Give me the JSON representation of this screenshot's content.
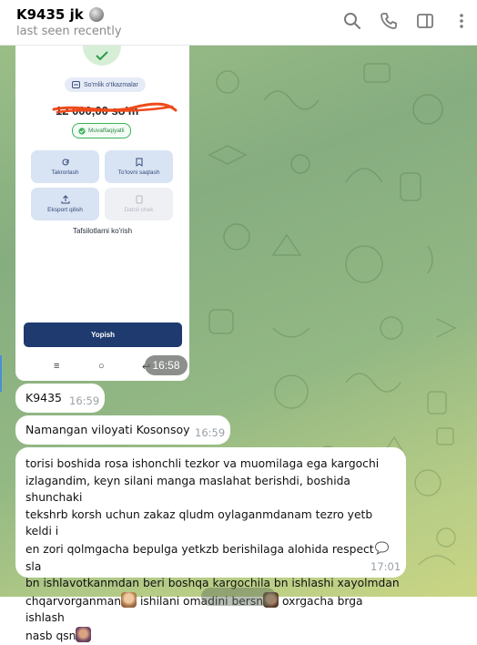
{
  "header": {
    "chat_name": "K9435 jk",
    "status": "last seen recently",
    "icons": [
      "search-icon",
      "phone-icon",
      "sidebar-toggle-icon",
      "more-icon"
    ]
  },
  "colors": {
    "chat_bg_start": "#9bbe87",
    "chat_bg_end": "#c9d584",
    "bubble": "#ffffff",
    "time_text": "#9aa0a6",
    "primary_button": "#1e3a6e",
    "success": "#3bb35a"
  },
  "image_message": {
    "receipt": {
      "transfer_type": "So'mlik o'tkazmalar",
      "amount": "12 000,00 so'm",
      "status": "Muvaffaqiyatli",
      "actions": [
        {
          "label": "Takrorlash",
          "icon": "repeat-icon"
        },
        {
          "label": "To'lovni saqlash",
          "icon": "save-icon"
        },
        {
          "label": "Eksport qilish",
          "icon": "export-icon"
        },
        {
          "label": "Datcil chek",
          "icon": "receipt-icon"
        }
      ],
      "details_link": "Tafsilotlarni ko'rish",
      "close_button": "Yopish",
      "nav_buttons": [
        "≡",
        "○",
        "↩"
      ]
    },
    "time": "16:58"
  },
  "messages": [
    {
      "text": "K9435",
      "time": "16:59"
    },
    {
      "text": "Namangan viloyati Kosonsoy",
      "time": "16:59"
    },
    {
      "line1": "torisi boshida rosa ishonchli tezkor va muomilaga ega kargochi",
      "line2": "izlagandim, keyn silani manga maslahat berishdi, boshida shunchaki",
      "line3": "tekshrb korsh uchun zakaz qludm oylaganmdanam tezro yetb keldi i",
      "line4a": "en zori qolmgacha bepulga yetkzb berishilaga alohida respect",
      "line4b": " sla",
      "line5": "bn ishlavotkanmdan beri boshqa kargochila bn ishlashi xayolmdan",
      "line6a": "chqarvorganman",
      "line6b": " ishilani omadini bersn",
      "line6c": " oxrgacha brga ishlash",
      "line7": "nasb qsn",
      "time": "17:01"
    }
  ]
}
